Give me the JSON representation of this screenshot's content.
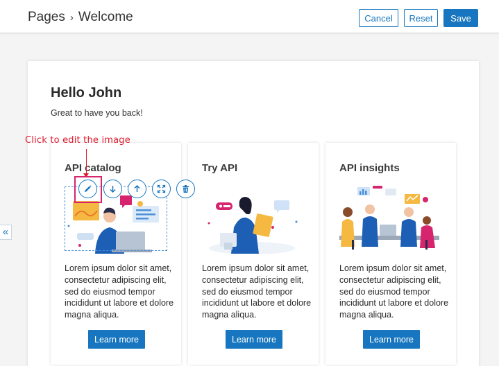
{
  "header": {
    "breadcrumb": [
      "Pages",
      "Welcome"
    ],
    "breadcrumb_separator": "›",
    "cancel_label": "Cancel",
    "reset_label": "Reset",
    "save_label": "Save"
  },
  "sidebar": {
    "collapse_glyph": "«",
    "collapse_icon": "double-chevron-left-icon"
  },
  "page": {
    "greeting": "Hello John",
    "subtitle": "Great to have you back!"
  },
  "annotation": {
    "label": "Click to edit the image"
  },
  "image_toolbar": [
    "pencil-icon",
    "arrow-down-icon",
    "arrow-up-icon",
    "expand-icon",
    "trash-icon"
  ],
  "cards": [
    {
      "title": "API catalog",
      "body": "Lorem ipsum dolor sit amet, consectetur adipiscing elit, sed do eiusmod tempor incididunt ut labore et dolore magna aliqua.",
      "button": "Learn more"
    },
    {
      "title": "Try API",
      "body": "Lorem ipsum dolor sit amet, consectetur adipiscing elit, sed do eiusmod tempor incididunt ut labore et dolore magna aliqua.",
      "button": "Learn more"
    },
    {
      "title": "API insights",
      "body": "Lorem ipsum dolor sit amet, consectetur adipiscing elit, sed do eiusmod tempor incididunt ut labore et dolore magna aliqua.",
      "button": "Learn more"
    }
  ],
  "colors": {
    "accent": "#1776bf",
    "annotation": "#e0192b",
    "highlight": "#d6246e"
  }
}
